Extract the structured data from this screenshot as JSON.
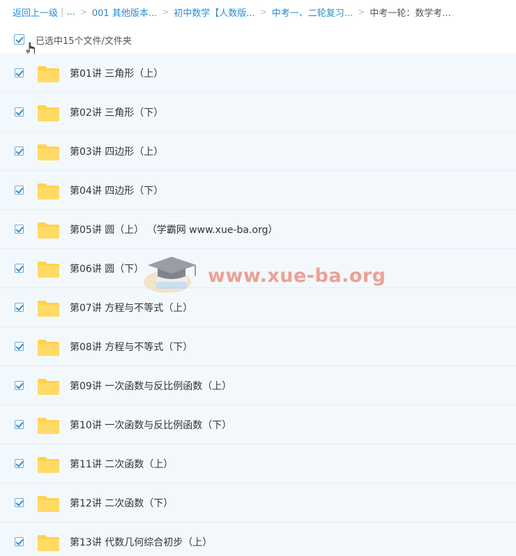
{
  "breadcrumb": {
    "back_label": "返回上一级",
    "ellipsis": "...",
    "items": [
      "001 其他版本...",
      "初中数学【人数版...",
      "中考一、二轮复习..."
    ],
    "current": "中考一轮：数学考..."
  },
  "selection": {
    "count_text": "已选中15个文件/文件夹",
    "checked": true
  },
  "files": [
    {
      "name": "第01讲 三角形（上）",
      "checked": true
    },
    {
      "name": "第02讲 三角形（下）",
      "checked": true
    },
    {
      "name": "第03讲 四边形（上）",
      "checked": true
    },
    {
      "name": "第04讲 四边形（下）",
      "checked": true
    },
    {
      "name": "第05讲 圆（上） （学霸网 www.xue-ba.org）",
      "checked": true
    },
    {
      "name": "第06讲 圆（下）",
      "checked": true
    },
    {
      "name": "第07讲 方程与不等式（上）",
      "checked": true
    },
    {
      "name": "第08讲 方程与不等式（下）",
      "checked": true
    },
    {
      "name": "第09讲 一次函数与反比例函数（上）",
      "checked": true
    },
    {
      "name": "第10讲 一次函数与反比例函数（下）",
      "checked": true
    },
    {
      "name": "第11讲 二次函数（上）",
      "checked": true
    },
    {
      "name": "第12讲 二次函数（下）",
      "checked": true
    },
    {
      "name": "第13讲 代数几何综合初步（上）",
      "checked": true
    }
  ],
  "watermark": {
    "text": "www.xue-ba.org"
  },
  "colors": {
    "link": "#2a8bd0",
    "row_bg": "#f3f8fd",
    "folder": "#ffd24d"
  },
  "icons": {
    "folder": "folder-icon",
    "checkbox": "checkbox-checked-icon",
    "cursor": "hand-pointer-icon"
  }
}
